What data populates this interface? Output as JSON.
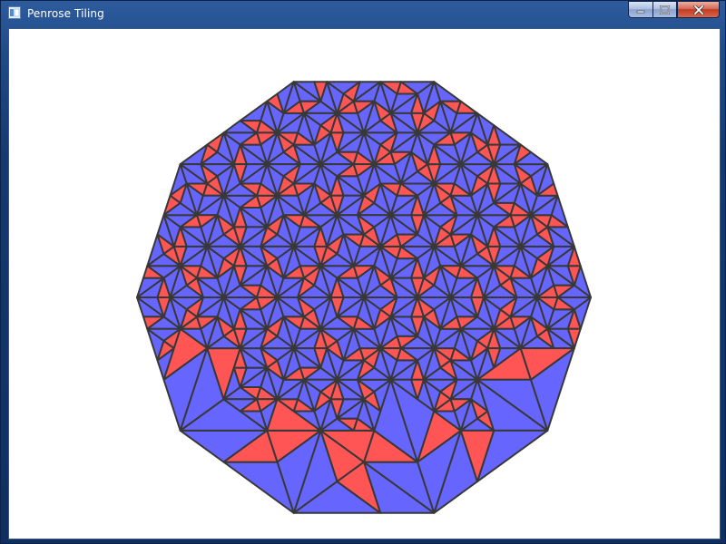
{
  "window": {
    "title": "Penrose Tiling",
    "controls": {
      "minimize": "minimize",
      "maximize": "maximize",
      "close": "close"
    }
  },
  "tiling": {
    "colors": {
      "thin": "#ff5555",
      "thick": "#6666ff",
      "edge": "#383838",
      "background": "#ffffff",
      "frame": "#0f2f60"
    },
    "shape": "decagon"
  }
}
